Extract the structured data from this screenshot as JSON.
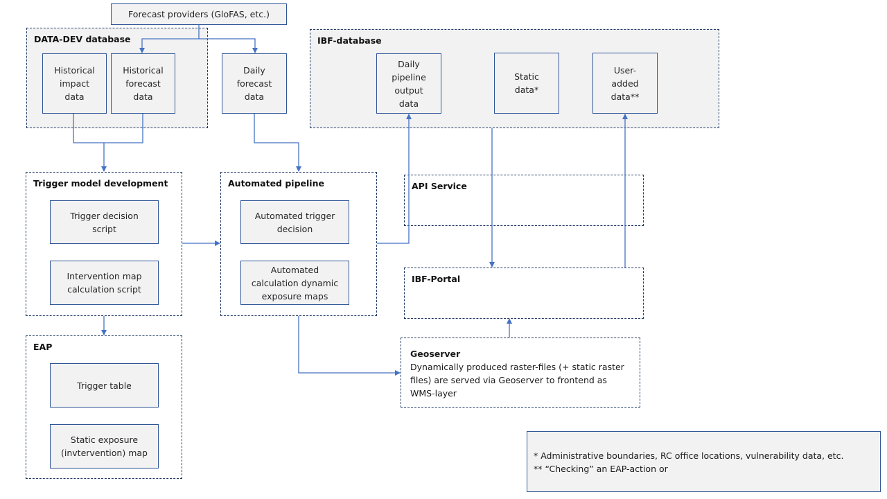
{
  "providers": {
    "label": "Forecast providers (GloFAS, etc.)"
  },
  "data_dev": {
    "title": "DATA-DEV database",
    "items": [
      {
        "label": "Historical\nimpact\ndata"
      },
      {
        "label": "Historical\nforecast\ndata"
      }
    ]
  },
  "daily_forecast": {
    "label": "Daily\nforecast\ndata"
  },
  "ibf_database": {
    "title": "IBF-database",
    "items": [
      {
        "label": "Daily\npipeline\noutput\ndata"
      },
      {
        "label": "Static\ndata*"
      },
      {
        "label": "User-\nadded\ndata**"
      }
    ]
  },
  "trigger_model": {
    "title": "Trigger model development",
    "items": [
      {
        "label": "Trigger decision\nscript"
      },
      {
        "label": "Intervention  map\ncalculation script"
      }
    ]
  },
  "pipeline": {
    "title": "Automated pipeline",
    "items": [
      {
        "label": "Automated  trigger\ndecision"
      },
      {
        "label": "Automated\ncalculation dynamic\nexposure maps"
      }
    ]
  },
  "api_service": {
    "title": "API Service"
  },
  "ibf_portal": {
    "title": "IBF-Portal"
  },
  "geoserver": {
    "title": "Geoserver",
    "description": "Dynamically produced  raster-files (+ static raster files) are served via Geoserver to frontend  as WMS-layer"
  },
  "eap": {
    "title": "EAP",
    "items": [
      {
        "label": "Trigger table"
      },
      {
        "label": "Static exposure\n(invtervention)  map"
      }
    ]
  },
  "footnotes": {
    "line1": "* Administrative boundaries, RC office locations, vulnerability data, etc.",
    "line2": "** “Checking” an EAP-action or"
  },
  "colors": {
    "connector": "#4472c4",
    "border": "#1f3864",
    "box_border": "#2f5597",
    "fill": "#f2f2f2"
  }
}
